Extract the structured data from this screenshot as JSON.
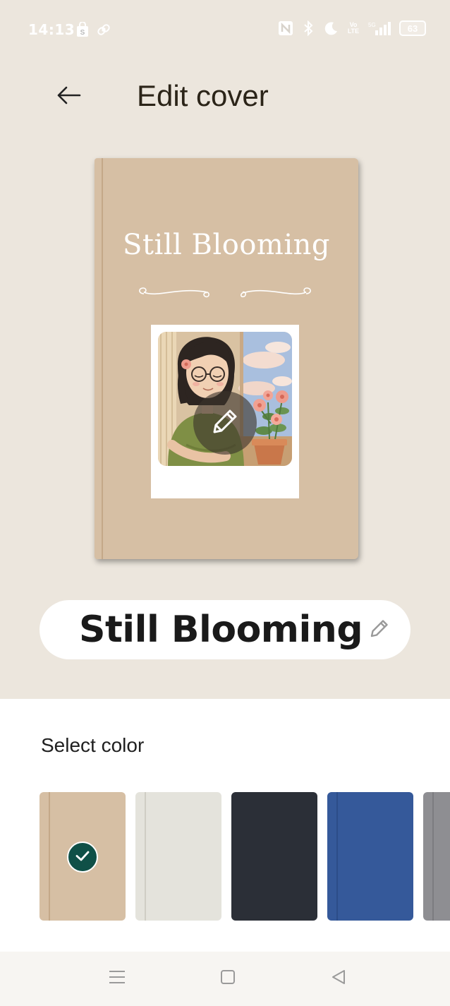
{
  "status_bar": {
    "time": "14:13",
    "left_icons": [
      "shopping-bag-icon",
      "link-icon"
    ],
    "right_icons": [
      "nfc-icon",
      "bluetooth-icon",
      "moon-icon",
      "volte-icon",
      "signal-icon"
    ],
    "volte_top": "Vo",
    "volte_bottom": "LTE",
    "battery": "63"
  },
  "header": {
    "back_icon": "arrow-left-icon",
    "title": "Edit cover"
  },
  "cover": {
    "title": "Still Blooming",
    "color": "#d6bfa4",
    "edit_photo_icon": "pencil-icon"
  },
  "title_field": {
    "value": "Still Blooming",
    "edit_icon": "pencil-icon"
  },
  "color_picker": {
    "label": "Select color",
    "selected_index": 0,
    "swatches": [
      {
        "color": "#d6bfa4",
        "spine": "#c4a888",
        "selected": true
      },
      {
        "color": "#e4e3dc",
        "spine": "#cfcdc4",
        "selected": false
      },
      {
        "color": "#2b2f37",
        "spine": "#2b2f37",
        "selected": false
      },
      {
        "color": "#35599a",
        "spine": "#2c4d88",
        "selected": false
      },
      {
        "color": "#8e8e92",
        "spine": "#7c7c80",
        "selected": false
      }
    ]
  },
  "nav_bar": {
    "buttons": [
      "menu-icon",
      "home-icon",
      "back-triangle-icon"
    ]
  }
}
